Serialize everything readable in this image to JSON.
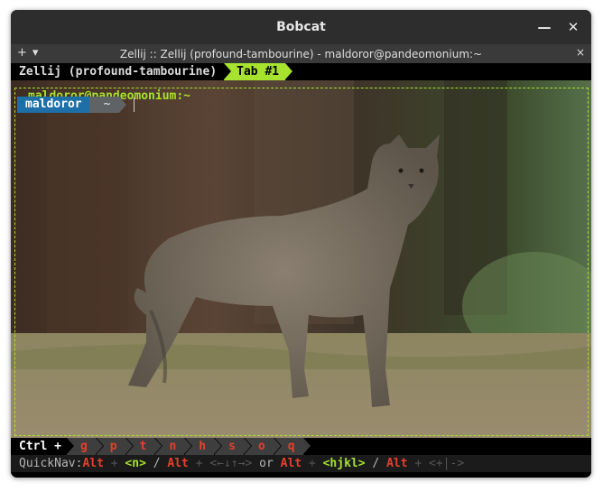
{
  "window": {
    "title": "Bobcat",
    "minimize_icon": "minimize-icon",
    "close_icon": "close-icon"
  },
  "tabbar": {
    "add_label": "+",
    "dropdown_label": "▾",
    "title": "Zellij :: Zellij (profound-tambourine) - maldoror@pandeomonium:~",
    "close_label": "×"
  },
  "zellij": {
    "session": "Zellij (profound-tambourine)",
    "tab": "Tab #1",
    "pane_title": "maldoror@pandeomonium:~",
    "prompt_user": "maldoror",
    "prompt_dir": "~"
  },
  "keybar": {
    "ctrl_label": "Ctrl +",
    "keys": [
      "g",
      "p",
      "t",
      "n",
      "h",
      "s",
      "o",
      "q"
    ]
  },
  "quicknav": {
    "label": "QuickNav:",
    "alt1": "Alt",
    "plus1": " + ",
    "k1": "<n>",
    "slash1": " / ",
    "alt2": "Alt",
    "plus2": " + ",
    "k2": "<←↓↑→>",
    "or": " or ",
    "alt3": "Alt",
    "plus3": " + ",
    "k3": "<hjkl>",
    "slash2": " / ",
    "alt4": "Alt",
    "plus4": " + ",
    "k4": "<+|->"
  },
  "colors": {
    "accent_green": "#a6e22e",
    "key_red": "#e5402b",
    "user_blue": "#1e6fa8"
  }
}
